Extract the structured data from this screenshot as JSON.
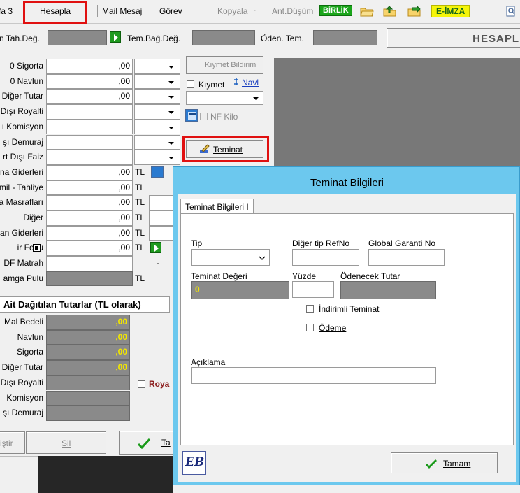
{
  "menubar": {
    "item_fa3": "fa 3",
    "hesapla": "Hesapla",
    "mail_mesaj": "Mail Mesaj",
    "gorev": "Görev",
    "kopyala": "Kopyala",
    "ant_dusum": "Ant.Düşüm",
    "birlik_badge": "BİRLİK",
    "eimza_badge": "E-İMZA"
  },
  "header_row": {
    "tah_deg_label": "n Tah.Değ.",
    "tem_bag_deg_label": "Tem.Bağ.Değ.",
    "oden_tem_label": "Öden. Tem.",
    "hesapl_label": "HESAPL"
  },
  "cost_rows": [
    {
      "label": "0  Sigorta",
      "value": ",00"
    },
    {
      "label": "0  Navlun",
      "value": ",00"
    },
    {
      "label": "Diğer Tutar",
      "value": ",00"
    },
    {
      "label": "Dışı Royalti",
      "value": ""
    },
    {
      "label": "ı Komisyon",
      "value": ""
    },
    {
      "label": "şı Demuraj",
      "value": ""
    },
    {
      "label": "rt Dışı Faiz",
      "value": ""
    },
    {
      "label": "na Giderleri",
      "value": ",00",
      "unit": "TL"
    },
    {
      "label": "mil - Tahliye",
      "value": ",00",
      "unit": "TL"
    },
    {
      "label": "a Masrafları",
      "value": ",00",
      "unit": "TL"
    },
    {
      "label": "Diğer",
      "value": ",00",
      "unit": "TL"
    },
    {
      "label": "an Giderleri",
      "value": ",00",
      "unit": "TL"
    },
    {
      "label": "ir Fonu",
      "value": ",00",
      "unit": "TL"
    },
    {
      "label": "DF Matrah",
      "value": "",
      "extra": "-"
    },
    {
      "label": "amga Pulu",
      "value": "",
      "unit": "TL"
    }
  ],
  "right_panel": {
    "kiymet_bildirim": "Kıymet Bildirim",
    "kiymet_label": "Kıymet",
    "navl_label": "Navl",
    "nf_kilo": "NF Kilo",
    "teminat_button": "Teminat"
  },
  "distributed": {
    "heading": "Ait Dağıtılan Tutarlar (TL olarak)",
    "rows": [
      {
        "label": "Mal Bedeli",
        "value": ",00"
      },
      {
        "label": "Navlun",
        "value": ",00"
      },
      {
        "label": "Sigorta",
        "value": ",00"
      },
      {
        "label": "Diğer Tutar",
        "value": ",00"
      },
      {
        "label": "Dışı Royalti",
        "value": ""
      },
      {
        "label": "Komisyon",
        "value": ""
      },
      {
        "label": "şı Demuraj",
        "value": ""
      }
    ],
    "roya_label": "Roya"
  },
  "bottom_buttons": {
    "degistir": "iştir",
    "sil": "Sil",
    "tamam_partial": "Ta"
  },
  "dialog": {
    "title": "Teminat Bilgileri",
    "tab_label": "Teminat Bilgileri I",
    "tip_label": "Tip",
    "diger_tip_refno_label": "Diğer tip RefNo",
    "global_garanti_no_label": "Global Garanti No",
    "teminat_degeri_label": "Teminat Değeri",
    "teminat_degeri_value": "0",
    "yuzde_label": "Yüzde",
    "odenecek_tutar_label": "Ödenecek Tutar",
    "indirimli_teminat_label": "İndirimli Teminat",
    "odeme_label": "Ödeme",
    "aciklama_label": "Açıklama",
    "tamam_button": "Tamam",
    "logo_text": "EB"
  },
  "colors": {
    "dialog_frame": "#6cc8ee",
    "highlight_red": "#e01010",
    "readonly_gray": "#8a8a8a",
    "value_yellow": "#f2e600",
    "birlik_bg": "#1aa51a",
    "eimza_bg": "#f5f50a"
  }
}
